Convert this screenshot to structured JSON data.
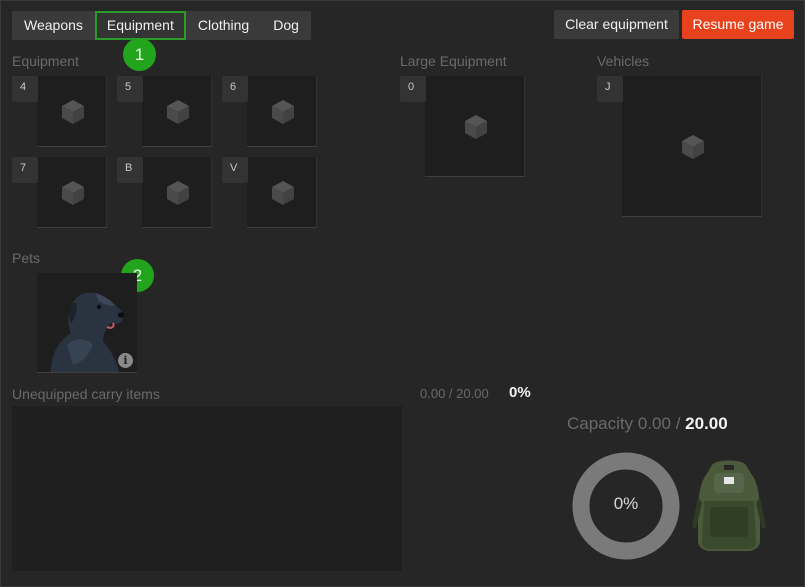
{
  "tabs": [
    {
      "label": "Weapons",
      "active": false
    },
    {
      "label": "Equipment",
      "active": true
    },
    {
      "label": "Clothing",
      "active": false
    },
    {
      "label": "Dog",
      "active": false
    }
  ],
  "actions": {
    "clear_label": "Clear equipment",
    "resume_label": "Resume game"
  },
  "badges": [
    "1",
    "2"
  ],
  "sections": {
    "equipment": "Equipment",
    "large_equipment": "Large Equipment",
    "vehicles": "Vehicles",
    "pets": "Pets",
    "unequipped": "Unequipped carry items"
  },
  "equipment_slots": [
    "4",
    "5",
    "6",
    "7",
    "B",
    "V"
  ],
  "large_equipment_slot": "0",
  "vehicle_slot": "J",
  "pet": {
    "icon": "dog-portrait",
    "info_icon": "i"
  },
  "carry": {
    "readout": "0.00 / 20.00",
    "percent_label": "0%"
  },
  "capacity": {
    "prefix": "Capacity ",
    "current": "0.00",
    "separator": " / ",
    "max": "20.00"
  },
  "gauge": {
    "label": "0%",
    "fill_fraction": 0,
    "ring_color": "#7a7a7a"
  },
  "colors": {
    "active_tab_border": "#2a9a2a",
    "resume_button": "#e8411d",
    "badge": "#22a51c"
  }
}
